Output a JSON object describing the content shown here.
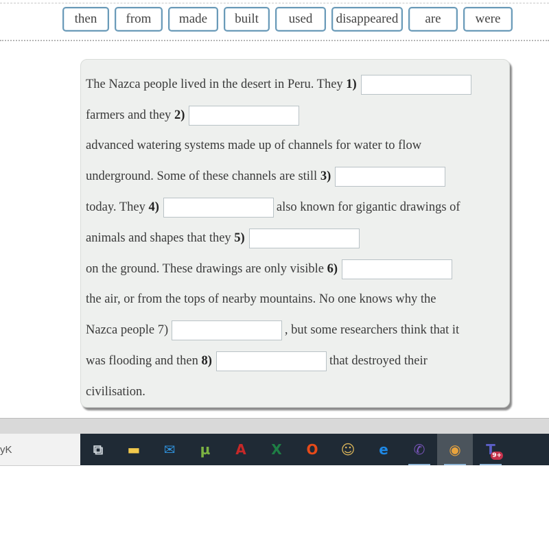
{
  "word_bank": [
    "then",
    "from",
    "made",
    "built",
    "used",
    "disappeared",
    "are",
    "were"
  ],
  "exercise": {
    "lines": [
      {
        "segments": [
          {
            "t": "text",
            "v": "The Nazca people lived in the desert in Peru. They "
          },
          {
            "t": "num",
            "v": "1)"
          },
          {
            "t": "blank",
            "id": "1"
          }
        ]
      },
      {
        "segments": [
          {
            "t": "text",
            "v": "farmers and they "
          },
          {
            "t": "num",
            "v": "2)"
          },
          {
            "t": "blank",
            "id": "2"
          }
        ]
      },
      {
        "segments": [
          {
            "t": "text",
            "v": "advanced watering systems made up of channels for water to flow"
          }
        ]
      },
      {
        "segments": [
          {
            "t": "text",
            "v": "underground. Some of these channels are still "
          },
          {
            "t": "num",
            "v": "3)"
          },
          {
            "t": "blank",
            "id": "3"
          }
        ]
      },
      {
        "segments": [
          {
            "t": "text",
            "v": "today. They "
          },
          {
            "t": "num",
            "v": "4)"
          },
          {
            "t": "blank",
            "id": "4"
          },
          {
            "t": "text",
            "v": "also known for gigantic drawings of"
          }
        ]
      },
      {
        "segments": [
          {
            "t": "text",
            "v": "animals and shapes that they "
          },
          {
            "t": "num",
            "v": "5)"
          },
          {
            "t": "blank",
            "id": "5"
          }
        ]
      },
      {
        "segments": [
          {
            "t": "text",
            "v": "on the ground. These drawings are only visible "
          },
          {
            "t": "num",
            "v": "6)"
          },
          {
            "t": "blank",
            "id": "6"
          }
        ]
      },
      {
        "segments": [
          {
            "t": "text",
            "v": "the air, or from the tops of nearby mountains. No one knows why the"
          }
        ]
      },
      {
        "segments": [
          {
            "t": "text",
            "v": "Nazca people 7) "
          },
          {
            "t": "blank",
            "id": "7"
          },
          {
            "t": "text",
            "v": ", but some researchers think that it"
          }
        ]
      },
      {
        "segments": [
          {
            "t": "text",
            "v": "was flooding and then "
          },
          {
            "t": "num",
            "v": "8)"
          },
          {
            "t": "blank",
            "id": "8"
          },
          {
            "t": "text",
            "v": "that destroyed their"
          }
        ]
      },
      {
        "segments": [
          {
            "t": "text",
            "v": "civilisation."
          }
        ]
      }
    ],
    "answers": {
      "1": "",
      "2": "",
      "3": "",
      "4": "",
      "5": "",
      "6": "",
      "7": "",
      "8": ""
    }
  },
  "left_bar_text": "yK",
  "taskbar": {
    "icons": [
      {
        "name": "task-view-icon",
        "glyph": "⧉",
        "color": "#cfd6dc"
      },
      {
        "name": "file-explorer-icon",
        "glyph": "▬",
        "color": "#f2c94c"
      },
      {
        "name": "mail-icon",
        "glyph": "✉",
        "color": "#2f8fd8"
      },
      {
        "name": "utorrent-icon",
        "glyph": "µ",
        "color": "#7cb342"
      },
      {
        "name": "acrobat-icon",
        "glyph": "A",
        "color": "#c62828"
      },
      {
        "name": "excel-icon",
        "glyph": "X",
        "color": "#1e7e45"
      },
      {
        "name": "office-icon",
        "glyph": "O",
        "color": "#e64a19"
      },
      {
        "name": "emoji-app-icon",
        "glyph": "☺",
        "color": "#d9b45a"
      },
      {
        "name": "edge-icon",
        "glyph": "e",
        "color": "#1e88e5"
      },
      {
        "name": "viber-icon",
        "glyph": "✆",
        "color": "#7e57c2"
      },
      {
        "name": "chrome-icon",
        "glyph": "◉",
        "color": "#e8a33d",
        "active": true
      },
      {
        "name": "teams-icon",
        "glyph": "T",
        "color": "#5b5fc7",
        "badge": "9+"
      }
    ]
  }
}
